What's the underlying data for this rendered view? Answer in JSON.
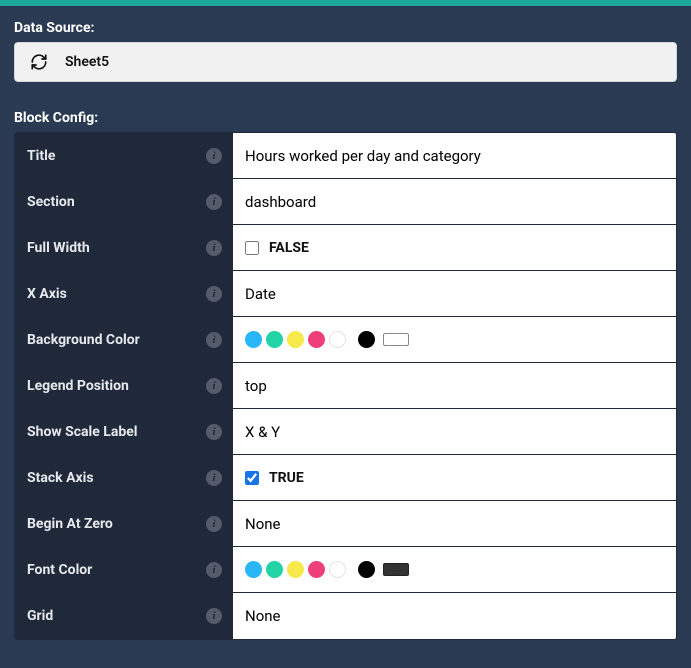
{
  "dataSource": {
    "label": "Data Source:",
    "value": "Sheet5"
  },
  "blockConfig": {
    "label": "Block Config:",
    "rows": {
      "title": {
        "label": "Title",
        "value": "Hours worked per day and category"
      },
      "section": {
        "label": "Section",
        "value": "dashboard"
      },
      "fullWidth": {
        "label": "Full Width",
        "checked": false,
        "boolText": "FALSE"
      },
      "xAxis": {
        "label": "X Axis",
        "value": "Date"
      },
      "bgColor": {
        "label": "Background Color"
      },
      "legendPos": {
        "label": "Legend Position",
        "value": "top"
      },
      "scaleLabel": {
        "label": "Show Scale Label",
        "value": "X & Y"
      },
      "stackAxis": {
        "label": "Stack Axis",
        "checked": true,
        "boolText": "TRUE"
      },
      "beginZero": {
        "label": "Begin At Zero",
        "value": "None"
      },
      "fontColor": {
        "label": "Font Color"
      },
      "grid": {
        "label": "Grid",
        "value": "None"
      }
    }
  },
  "colorSwatches": {
    "palette": [
      "#29b6f6",
      "#22d3a5",
      "#f7e84b",
      "#ef3f7a",
      "#ffffff",
      "#000000"
    ]
  }
}
